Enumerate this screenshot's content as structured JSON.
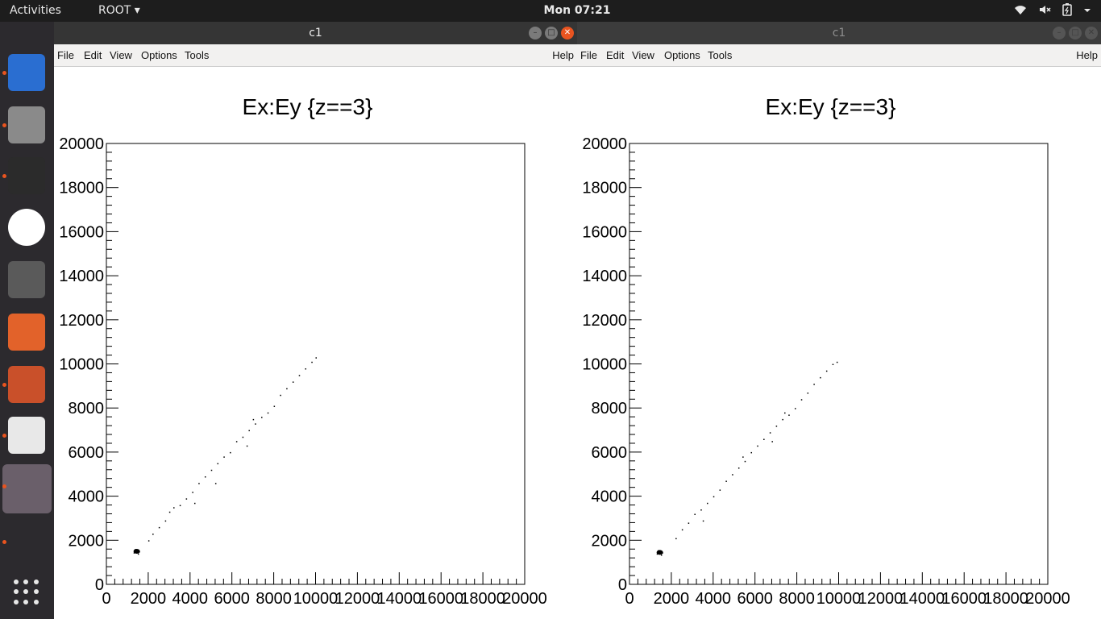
{
  "topbar": {
    "activities": "Activities",
    "app_menu": "ROOT",
    "clock": "Mon 07:21"
  },
  "dock": {
    "apps": [
      {
        "name": "Thunderbird Mail",
        "icon": "thunderbird-icon",
        "color": "#2a6ed1"
      },
      {
        "name": "Files",
        "icon": "files-icon",
        "color": "#8a8a8a"
      },
      {
        "name": "Terminal",
        "icon": "terminal-icon",
        "color": "#2b2b2b"
      },
      {
        "name": "Slack",
        "icon": "slack-icon",
        "color": "#ffffff"
      },
      {
        "name": "TeXmaker",
        "icon": "texmaker-icon",
        "color": "#5a5a5a"
      },
      {
        "name": "Ubuntu Software",
        "icon": "software-center-icon",
        "color": "#e2622a"
      },
      {
        "name": "LibreOffice Impress",
        "icon": "impress-icon",
        "color": "#c9502a"
      },
      {
        "name": "Document Viewer",
        "icon": "evince-icon",
        "color": "#e8e8e8"
      },
      {
        "name": "ROOT",
        "icon": "root-app-icon",
        "color": "#6a5f6a"
      }
    ],
    "show_apps": "show-applications-icon"
  },
  "windows": [
    {
      "title": "c1",
      "active": true,
      "menu": [
        "File",
        "Edit",
        "View",
        "Options",
        "Tools"
      ],
      "help": "Help"
    },
    {
      "title": "c1",
      "active": false,
      "menu": [
        "File",
        "Edit",
        "View",
        "Options",
        "Tools"
      ],
      "help": "Help"
    }
  ],
  "chart_data": [
    {
      "type": "scatter",
      "title": "Ex:Ey {z==3}",
      "xlabel": "",
      "ylabel": "",
      "xlim": [
        0,
        20000
      ],
      "ylim": [
        0,
        20000
      ],
      "xticks": [
        "0",
        "2000",
        "4000",
        "6000",
        "8000",
        "10000",
        "12000",
        "14000",
        "16000",
        "18000",
        "20000"
      ],
      "yticks": [
        "0",
        "2000",
        "4000",
        "6000",
        "8000",
        "10000",
        "12000",
        "14000",
        "16000",
        "18000",
        "20000"
      ],
      "grid": false,
      "cluster": {
        "x": 1450,
        "y": 1500
      },
      "points": [
        [
          1300,
          1450
        ],
        [
          1400,
          1550
        ],
        [
          1500,
          1400
        ],
        [
          1550,
          1500
        ],
        [
          1350,
          1600
        ],
        [
          2000,
          2000
        ],
        [
          2200,
          2300
        ],
        [
          2500,
          2600
        ],
        [
          2800,
          2900
        ],
        [
          3000,
          3300
        ],
        [
          3200,
          3500
        ],
        [
          3500,
          3600
        ],
        [
          3800,
          3900
        ],
        [
          4100,
          4200
        ],
        [
          4400,
          4600
        ],
        [
          4700,
          4900
        ],
        [
          5000,
          5200
        ],
        [
          5300,
          5500
        ],
        [
          5600,
          5800
        ],
        [
          5900,
          6000
        ],
        [
          6200,
          6500
        ],
        [
          6500,
          6700
        ],
        [
          6800,
          7000
        ],
        [
          7100,
          7300
        ],
        [
          7400,
          7600
        ],
        [
          7700,
          7800
        ],
        [
          8000,
          8100
        ],
        [
          8300,
          8600
        ],
        [
          8600,
          8900
        ],
        [
          8900,
          9200
        ],
        [
          9200,
          9500
        ],
        [
          9500,
          9800
        ],
        [
          9800,
          10100
        ],
        [
          10000,
          10300
        ],
        [
          4200,
          3700
        ],
        [
          5200,
          4600
        ],
        [
          6700,
          6300
        ],
        [
          7000,
          7500
        ]
      ]
    },
    {
      "type": "scatter",
      "title": "Ex:Ey {z==3}",
      "xlabel": "",
      "ylabel": "",
      "xlim": [
        0,
        20000
      ],
      "ylim": [
        0,
        20000
      ],
      "xticks": [
        "0",
        "2000",
        "4000",
        "6000",
        "8000",
        "10000",
        "12000",
        "14000",
        "16000",
        "18000",
        "20000"
      ],
      "yticks": [
        "0",
        "2000",
        "4000",
        "6000",
        "8000",
        "10000",
        "12000",
        "14000",
        "16000",
        "18000",
        "20000"
      ],
      "grid": false,
      "cluster": {
        "x": 1450,
        "y": 1450
      },
      "points": [
        [
          1300,
          1400
        ],
        [
          1400,
          1500
        ],
        [
          1500,
          1350
        ],
        [
          1550,
          1450
        ],
        [
          1350,
          1550
        ],
        [
          2200,
          2100
        ],
        [
          2500,
          2500
        ],
        [
          2800,
          2800
        ],
        [
          3100,
          3200
        ],
        [
          3400,
          3400
        ],
        [
          3700,
          3700
        ],
        [
          4000,
          4000
        ],
        [
          4300,
          4300
        ],
        [
          4600,
          4700
        ],
        [
          4900,
          5000
        ],
        [
          5200,
          5300
        ],
        [
          5500,
          5600
        ],
        [
          5800,
          6000
        ],
        [
          6100,
          6300
        ],
        [
          6400,
          6600
        ],
        [
          6700,
          6900
        ],
        [
          7000,
          7200
        ],
        [
          7300,
          7500
        ],
        [
          7600,
          7700
        ],
        [
          7900,
          8000
        ],
        [
          8200,
          8400
        ],
        [
          8500,
          8700
        ],
        [
          8800,
          9100
        ],
        [
          9100,
          9400
        ],
        [
          9400,
          9700
        ],
        [
          9700,
          10000
        ],
        [
          9900,
          10100
        ],
        [
          3500,
          2900
        ],
        [
          5400,
          5800
        ],
        [
          6800,
          6500
        ],
        [
          7400,
          7800
        ]
      ]
    }
  ]
}
